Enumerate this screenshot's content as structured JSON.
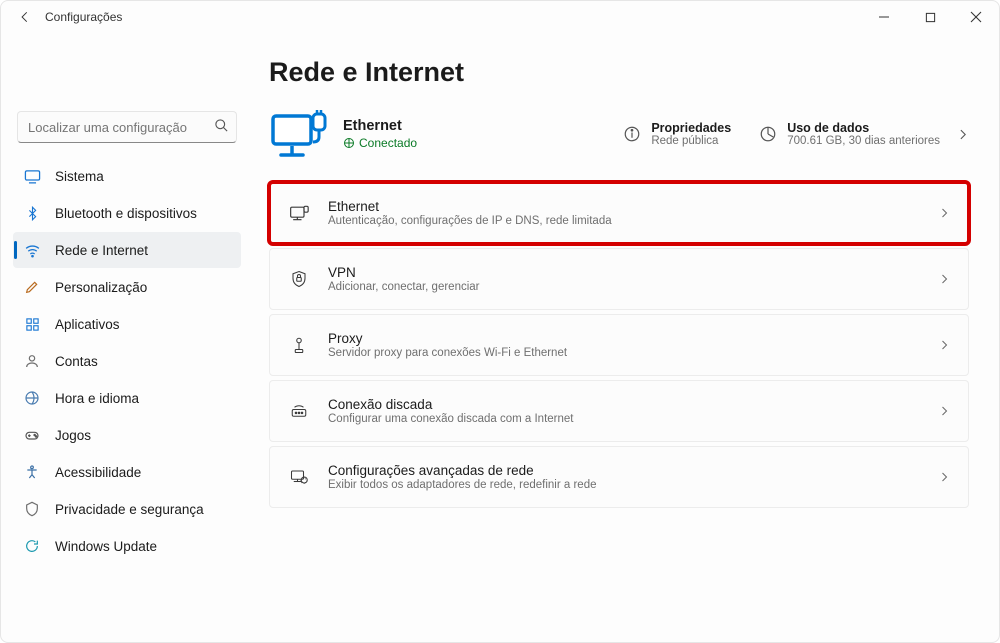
{
  "window": {
    "title": "Configurações"
  },
  "search": {
    "placeholder": "Localizar uma configuração"
  },
  "sidebar": {
    "items": [
      {
        "label": "Sistema"
      },
      {
        "label": "Bluetooth e dispositivos"
      },
      {
        "label": "Rede e Internet"
      },
      {
        "label": "Personalização"
      },
      {
        "label": "Aplicativos"
      },
      {
        "label": "Contas"
      },
      {
        "label": "Hora e idioma"
      },
      {
        "label": "Jogos"
      },
      {
        "label": "Acessibilidade"
      },
      {
        "label": "Privacidade e segurança"
      },
      {
        "label": "Windows Update"
      }
    ]
  },
  "page": {
    "title": "Rede e Internet",
    "status": {
      "name": "Ethernet",
      "state": "Conectado"
    },
    "properties": {
      "title": "Propriedades",
      "sub": "Rede pública"
    },
    "usage": {
      "title": "Uso de dados",
      "sub": "700.61 GB, 30 dias anteriores"
    },
    "cards": [
      {
        "title": "Ethernet",
        "sub": "Autenticação, configurações de IP e DNS, rede limitada"
      },
      {
        "title": "VPN",
        "sub": "Adicionar, conectar, gerenciar"
      },
      {
        "title": "Proxy",
        "sub": "Servidor proxy para conexões Wi-Fi e Ethernet"
      },
      {
        "title": "Conexão discada",
        "sub": "Configurar uma conexão discada com a Internet"
      },
      {
        "title": "Configurações avançadas de rede",
        "sub": "Exibir todos os adaptadores de rede, redefinir a rede"
      }
    ]
  }
}
